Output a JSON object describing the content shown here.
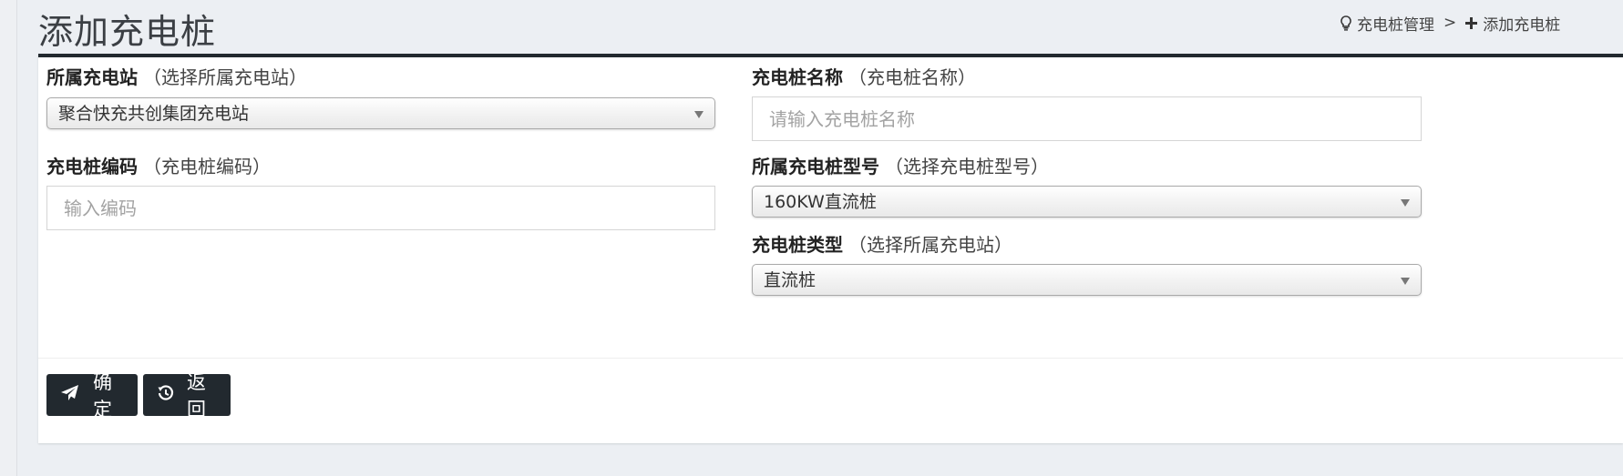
{
  "page": {
    "title": "添加充电桩"
  },
  "breadcrumb": {
    "parent": "充电桩管理",
    "separator": ">",
    "current": "添加充电桩"
  },
  "form": {
    "station": {
      "label": "所属充电站",
      "hint": "（选择所属充电站）",
      "value": "聚合快充共创集团充电站"
    },
    "pile_name": {
      "label": "充电桩名称",
      "hint": "（充电桩名称）",
      "placeholder": "请输入充电桩名称"
    },
    "pile_code": {
      "label": "充电桩编码",
      "hint": "（充电桩编码）",
      "placeholder": "输入编码"
    },
    "pile_model": {
      "label": "所属充电桩型号",
      "hint": "（选择充电桩型号）",
      "value": "160KW直流桩"
    },
    "pile_type": {
      "label": "充电桩类型",
      "hint": "（选择所属充电站）",
      "value": "直流桩"
    }
  },
  "actions": {
    "confirm": "确定",
    "back": "返回"
  },
  "icons": {
    "breadcrumb_parent": "lightbulb-icon",
    "breadcrumb_current": "plus-icon",
    "confirm": "paper-plane-icon",
    "back": "history-icon"
  },
  "colors": {
    "accent": "#22292f",
    "background": "#eceff3",
    "card": "#ffffff"
  }
}
